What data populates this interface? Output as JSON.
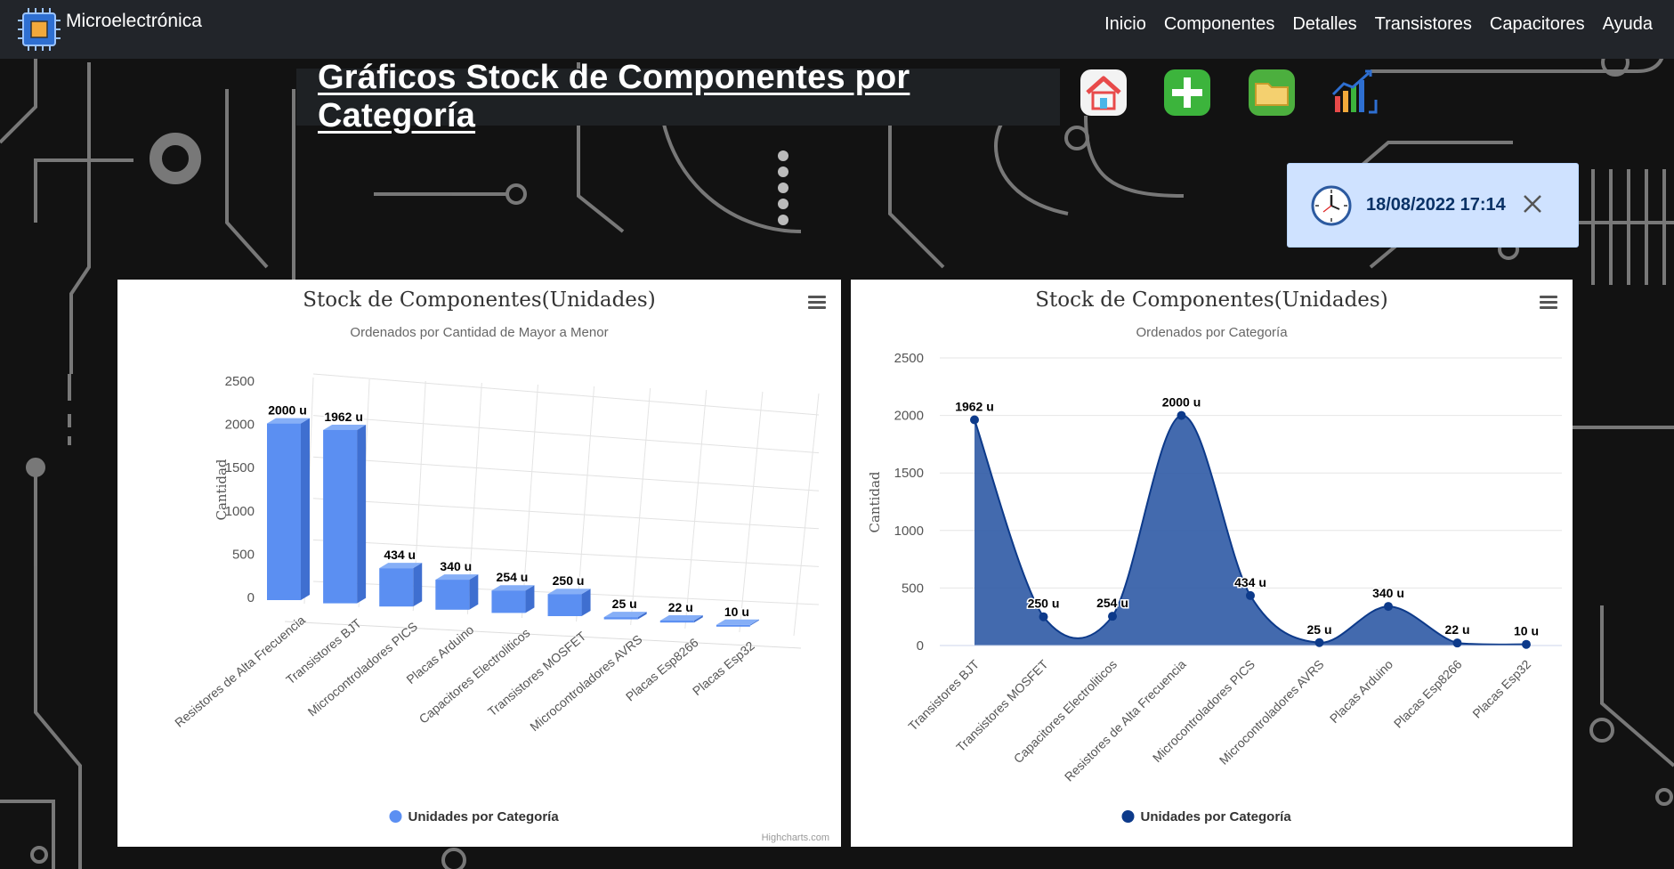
{
  "brand": {
    "name": "Microelectrónica",
    "logo_icon": "microchip-icon"
  },
  "nav": {
    "items": [
      "Inicio",
      "Componentes",
      "Detalles",
      "Transistores",
      "Capacitores",
      "Ayuda"
    ]
  },
  "page": {
    "title": "Gráficos Stock de Componentes por Categoría"
  },
  "toolbar": {
    "icons": [
      "home-icon",
      "add-icon",
      "folder-icon",
      "chart-icon"
    ]
  },
  "toast": {
    "datetime": "18/08/2022 17:14",
    "icon": "clock-icon"
  },
  "colors": {
    "bar": "#5b8ff2",
    "area": "#2f5aa5",
    "area_line": "#0d3a8a",
    "toast_bg": "#cfe2ff"
  },
  "credits": "Highcharts.com",
  "chart_data": [
    {
      "type": "bar",
      "variant": "3d",
      "title": "Stock de Componentes(Unidades)",
      "subtitle": "Ordenados por Cantidad de Mayor a Menor",
      "ylabel": "Cantidad",
      "ylim": [
        0,
        2500
      ],
      "yticks": [
        0,
        500,
        1000,
        1500,
        2000,
        2500
      ],
      "categories": [
        "Resistores de Alta Frecuencia",
        "Transistores BJT",
        "Microcontroladores PICS",
        "Placas Arduino",
        "Capacitores Electroliticos",
        "Transistores MOSFET",
        "Microcontroladores AVRS",
        "Placas Esp8266",
        "Placas Esp32"
      ],
      "series": [
        {
          "name": "Unidades por Categoría",
          "values": [
            2000,
            1962,
            434,
            340,
            254,
            250,
            25,
            22,
            10
          ]
        }
      ],
      "data_label_suffix": " u",
      "legend": "bottom-center",
      "grid": true
    },
    {
      "type": "area",
      "variant": "spline",
      "title": "Stock de Componentes(Unidades)",
      "subtitle": "Ordenados por Categoría",
      "ylabel": "Cantidad",
      "ylim": [
        0,
        2500
      ],
      "yticks": [
        0,
        500,
        1000,
        1500,
        2000,
        2500
      ],
      "categories": [
        "Transistores BJT",
        "Transistores MOSFET",
        "Capacitores Electroliticos",
        "Resistores de Alta Frecuencia",
        "Microcontroladores PICS",
        "Microcontroladores AVRS",
        "Placas Arduino",
        "Placas Esp8266",
        "Placas Esp32"
      ],
      "series": [
        {
          "name": "Unidades por Categoría",
          "values": [
            1962,
            250,
            254,
            2000,
            434,
            25,
            340,
            22,
            10
          ]
        }
      ],
      "data_label_suffix": " u",
      "legend": "bottom-center",
      "grid": true
    }
  ]
}
